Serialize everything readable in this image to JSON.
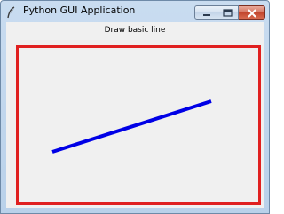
{
  "window": {
    "title": "Python GUI Application",
    "app_icon": "feather-icon",
    "controls": [
      "minimize-icon",
      "maximize-icon",
      "close-icon"
    ]
  },
  "canvas": {
    "label": "Draw basic line",
    "border_color": "#e02020",
    "background": "#f0f0f0",
    "line": {
      "color": "#0000e6"
    }
  }
}
